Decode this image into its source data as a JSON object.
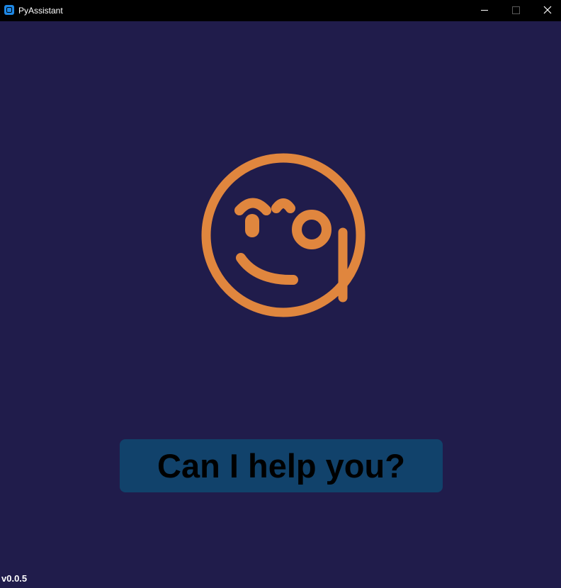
{
  "window": {
    "title": "PyAssistant",
    "icons": {
      "app": "app-window-icon",
      "minimize": "minimize-icon",
      "maximize": "maximize-icon",
      "close": "close-icon"
    }
  },
  "colors": {
    "background": "#201c4b",
    "titlebar": "#000000",
    "accent": "#e0863e",
    "button": "#11426b",
    "button_text": "#000000",
    "version_text": "#ffffff"
  },
  "logo": {
    "icon": "winking-monocle-face-icon"
  },
  "prompt_button": {
    "label": "Can I help you?"
  },
  "footer": {
    "version": "v0.0.5"
  }
}
